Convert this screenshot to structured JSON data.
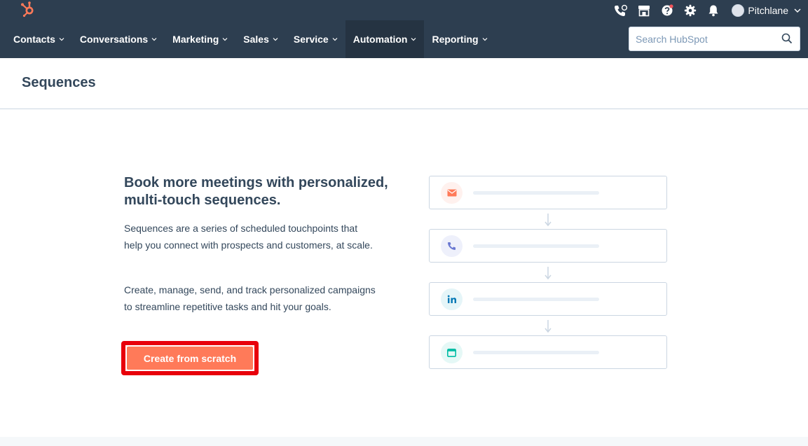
{
  "topbar": {
    "icons": [
      "hubspot-logo",
      "calling-icon",
      "marketplace-icon",
      "help-icon",
      "settings-icon",
      "notifications-icon"
    ],
    "account_name": "Pitchlane"
  },
  "nav": {
    "items": [
      {
        "label": "Contacts"
      },
      {
        "label": "Conversations"
      },
      {
        "label": "Marketing"
      },
      {
        "label": "Sales"
      },
      {
        "label": "Service"
      },
      {
        "label": "Automation"
      },
      {
        "label": "Reporting"
      }
    ],
    "active": "Automation"
  },
  "search": {
    "placeholder": "Search HubSpot"
  },
  "page": {
    "title": "Sequences"
  },
  "empty_state": {
    "headline": "Book more meetings with personalized, multi-touch sequences.",
    "paragraph1": "Sequences are a series of scheduled touchpoints that help you connect with prospects and customers, at scale.",
    "paragraph2": "Create, manage, send, and track personalized campaigns to streamline repetitive tasks and hit your goals.",
    "cta_label": "Create from scratch"
  },
  "illustration": {
    "steps": [
      {
        "icon": "email-icon",
        "color": "#ff7a59",
        "bg": "#fff1ee"
      },
      {
        "icon": "phone-icon",
        "color": "#6a78d1",
        "bg": "#eef0fb"
      },
      {
        "icon": "linkedin-icon",
        "color": "#0077b5",
        "bg": "#e5f5f8"
      },
      {
        "icon": "task-icon",
        "color": "#00bda5",
        "bg": "#e5f8f6"
      }
    ]
  },
  "colors": {
    "nav_bg": "#2d3e50",
    "accent": "#ff7a59",
    "highlight": "#e8000b",
    "text": "#33475b"
  }
}
